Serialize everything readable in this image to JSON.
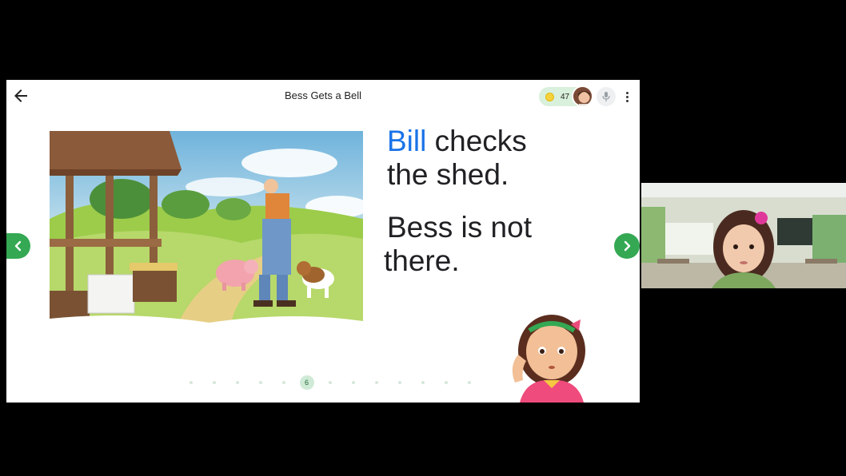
{
  "header": {
    "title": "Bess Gets a Bell",
    "points": "47",
    "back_icon": "arrow-left-icon",
    "more_icon": "more-vert-icon",
    "mic_icon": "mic-icon"
  },
  "page": {
    "highlight_word": "Bill",
    "line1_rest": " checks",
    "line2": "the shed.",
    "line3": "Bess is not",
    "line4": "there."
  },
  "pagination": {
    "current": "6",
    "total_dots": 13,
    "active_index": 5
  },
  "colors": {
    "accent_green": "#34a853",
    "highlight_blue": "#1a73e8",
    "points_pill": "#d9f0dc"
  }
}
